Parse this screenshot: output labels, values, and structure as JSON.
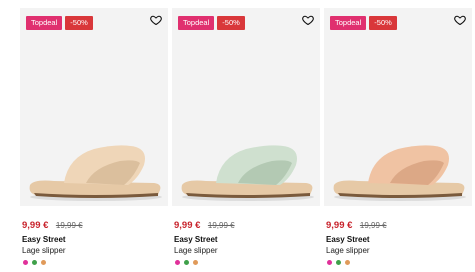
{
  "products": [
    {
      "badge_topdeal": "Topdeal",
      "badge_discount": "-50%",
      "price_new": "9,99 €",
      "price_old": "19,99 €",
      "brand": "Easy Street",
      "description": "Lage slipper",
      "strap_color": "#efd6b8",
      "strap_shadow": "#dbbf9d",
      "sole_color": "#e6c9a6",
      "swatches": [
        "#e0309a",
        "#3fa04a",
        "#e09a5a"
      ]
    },
    {
      "badge_topdeal": "Topdeal",
      "badge_discount": "-50%",
      "price_new": "9,99 €",
      "price_old": "19,99 €",
      "brand": "Easy Street",
      "description": "Lage slipper",
      "strap_color": "#cfe0cf",
      "strap_shadow": "#b3c9b3",
      "sole_color": "#e6c9a6",
      "swatches": [
        "#e0309a",
        "#3fa04a",
        "#e09a5a"
      ]
    },
    {
      "badge_topdeal": "Topdeal",
      "badge_discount": "-50%",
      "price_new": "9,99 €",
      "price_old": "19,99 €",
      "brand": "Easy Street",
      "description": "Lage slipper",
      "strap_color": "#f0c3a3",
      "strap_shadow": "#dca886",
      "sole_color": "#e6c9a6",
      "swatches": [
        "#e0309a",
        "#3fa04a",
        "#e09a5a"
      ]
    }
  ],
  "icons": {
    "wishlist": "heart-outline-icon"
  },
  "colors": {
    "topdeal_badge": "#e0306f",
    "discount_badge": "#d9373a",
    "sale_price": "#c8232c",
    "image_background": "#f3f3f3"
  }
}
